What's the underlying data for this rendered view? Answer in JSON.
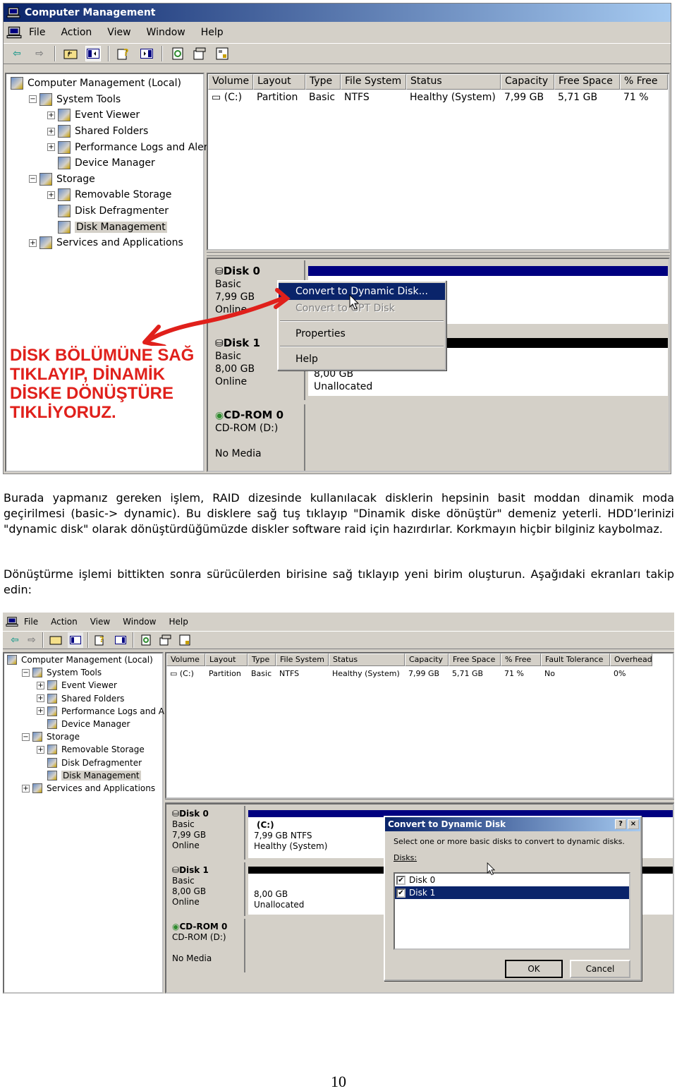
{
  "screenshot1": {
    "title": "Computer Management",
    "menu": [
      "File",
      "Action",
      "View",
      "Window",
      "Help"
    ],
    "toolbar_icons": [
      "back-icon",
      "forward-icon",
      "up-folder-icon",
      "show-hide-tree-icon",
      "help-icon",
      "show-hide-action-pane-icon",
      "refresh-icon",
      "properties-icon",
      "export-icon"
    ],
    "tree": [
      {
        "label": "Computer Management (Local)",
        "level": 0,
        "expander": "",
        "icon": "computer-icon"
      },
      {
        "label": "System Tools",
        "level": 1,
        "expander": "−",
        "icon": "tools-icon"
      },
      {
        "label": "Event Viewer",
        "level": 2,
        "expander": "+",
        "icon": "event-viewer-icon"
      },
      {
        "label": "Shared Folders",
        "level": 2,
        "expander": "+",
        "icon": "folder-icon"
      },
      {
        "label": "Performance Logs and Alert:",
        "level": 2,
        "expander": "+",
        "icon": "performance-icon"
      },
      {
        "label": "Device Manager",
        "level": 2,
        "expander": "",
        "icon": "device-manager-icon"
      },
      {
        "label": "Storage",
        "level": 1,
        "expander": "−",
        "icon": "storage-icon"
      },
      {
        "label": "Removable Storage",
        "level": 2,
        "expander": "+",
        "icon": "removable-storage-icon"
      },
      {
        "label": "Disk Defragmenter",
        "level": 2,
        "expander": "",
        "icon": "defrag-icon"
      },
      {
        "label": "Disk Management",
        "level": 2,
        "expander": "",
        "icon": "disk-management-icon",
        "selected": true
      },
      {
        "label": "Services and Applications",
        "level": 1,
        "expander": "+",
        "icon": "services-icon"
      }
    ],
    "columns": [
      "Volume",
      "Layout",
      "Type",
      "File System",
      "Status",
      "Capacity",
      "Free Space",
      "% Free"
    ],
    "rows": [
      [
        "(C:)",
        "Partition",
        "Basic",
        "NTFS",
        "Healthy (System)",
        "7,99 GB",
        "5,71 GB",
        "71 %"
      ]
    ],
    "disks": [
      {
        "name": "Disk 0",
        "type": "Basic",
        "size": "7,99 GB",
        "status": "Online"
      },
      {
        "name": "Disk 1",
        "type": "Basic",
        "size": "8,00 GB",
        "status": "Online",
        "part_size": "8,00 GB",
        "part_status": "Unallocated"
      },
      {
        "name": "CD-ROM 0",
        "type": "CD-ROM (D:)",
        "status": "No Media"
      }
    ],
    "context_menu": [
      {
        "label": "Convert to Dynamic Disk...",
        "state": "highlighted"
      },
      {
        "label": "Convert to GPT Disk",
        "state": "disabled"
      },
      {
        "label": "Properties",
        "state": "normal"
      },
      {
        "label": "Help",
        "state": "normal"
      }
    ],
    "annotation": [
      "DİSK BÖLÜMÜNE SAĞ",
      "TIKLAYIP, DİNAMİK",
      "DİSKE DÖNÜŞTÜRE",
      "TIKLİYORUZ."
    ],
    "annotation_color": "#e0201b"
  },
  "paragraphs": [
    "Burada yapmanız gereken işlem, RAID dizesinde kullanılacak disklerin hepsinin basit moddan dinamik moda geçirilmesi (basic-> dynamic). Bu disklere sağ tuş tıklayıp \"Dinamik diske dönüştür\" demeniz yeterli. HDD’lerinizi \"dynamic disk\" olarak dönüştürdüğümüzde diskler software raid için hazırdırlar. Korkmayın hiçbir bilginiz kaybolmaz.",
    "Dönüştürme işlemi bittikten sonra sürücülerden birisine sağ tıklayıp yeni birim oluşturun. Aşağıdaki ekranları takip edin:"
  ],
  "screenshot2": {
    "menu": [
      "File",
      "Action",
      "View",
      "Window",
      "Help"
    ],
    "tree": [
      {
        "label": "Computer Management (Local)",
        "level": 0,
        "expander": ""
      },
      {
        "label": "System Tools",
        "level": 1,
        "expander": "−"
      },
      {
        "label": "Event Viewer",
        "level": 2,
        "expander": "+"
      },
      {
        "label": "Shared Folders",
        "level": 2,
        "expander": "+"
      },
      {
        "label": "Performance Logs and Alert:",
        "level": 2,
        "expander": "+"
      },
      {
        "label": "Device Manager",
        "level": 2,
        "expander": ""
      },
      {
        "label": "Storage",
        "level": 1,
        "expander": "−"
      },
      {
        "label": "Removable Storage",
        "level": 2,
        "expander": "+"
      },
      {
        "label": "Disk Defragmenter",
        "level": 2,
        "expander": ""
      },
      {
        "label": "Disk Management",
        "level": 2,
        "expander": "",
        "selected": true
      },
      {
        "label": "Services and Applications",
        "level": 1,
        "expander": "+"
      }
    ],
    "columns": [
      "Volume",
      "Layout",
      "Type",
      "File System",
      "Status",
      "Capacity",
      "Free Space",
      "% Free",
      "Fault Tolerance",
      "Overhead"
    ],
    "rows": [
      [
        "(C:)",
        "Partition",
        "Basic",
        "NTFS",
        "Healthy (System)",
        "7,99 GB",
        "5,71 GB",
        "71 %",
        "No",
        "0%"
      ]
    ],
    "disks": [
      {
        "name": "Disk 0",
        "type": "Basic",
        "size": "7,99 GB",
        "status": "Online",
        "vol": "(C:)",
        "vol_info": "7,99 GB NTFS",
        "vol_status": "Healthy (System)"
      },
      {
        "name": "Disk 1",
        "type": "Basic",
        "size": "8,00 GB",
        "status": "Online",
        "part_size": "8,00 GB",
        "part_status": "Unallocated"
      },
      {
        "name": "CD-ROM 0",
        "type": "CD-ROM (D:)",
        "status": "No Media"
      }
    ],
    "dialog": {
      "title": "Convert to Dynamic Disk",
      "help_btn": "?",
      "close_btn": "×",
      "instruction": "Select one or more basic disks to convert to dynamic disks.",
      "list_label": "Disks:",
      "items": [
        {
          "label": "Disk 0",
          "checked": true,
          "selected": false
        },
        {
          "label": "Disk 1",
          "checked": true,
          "selected": true
        }
      ],
      "ok": "OK",
      "cancel": "Cancel"
    }
  },
  "page_number": "10"
}
